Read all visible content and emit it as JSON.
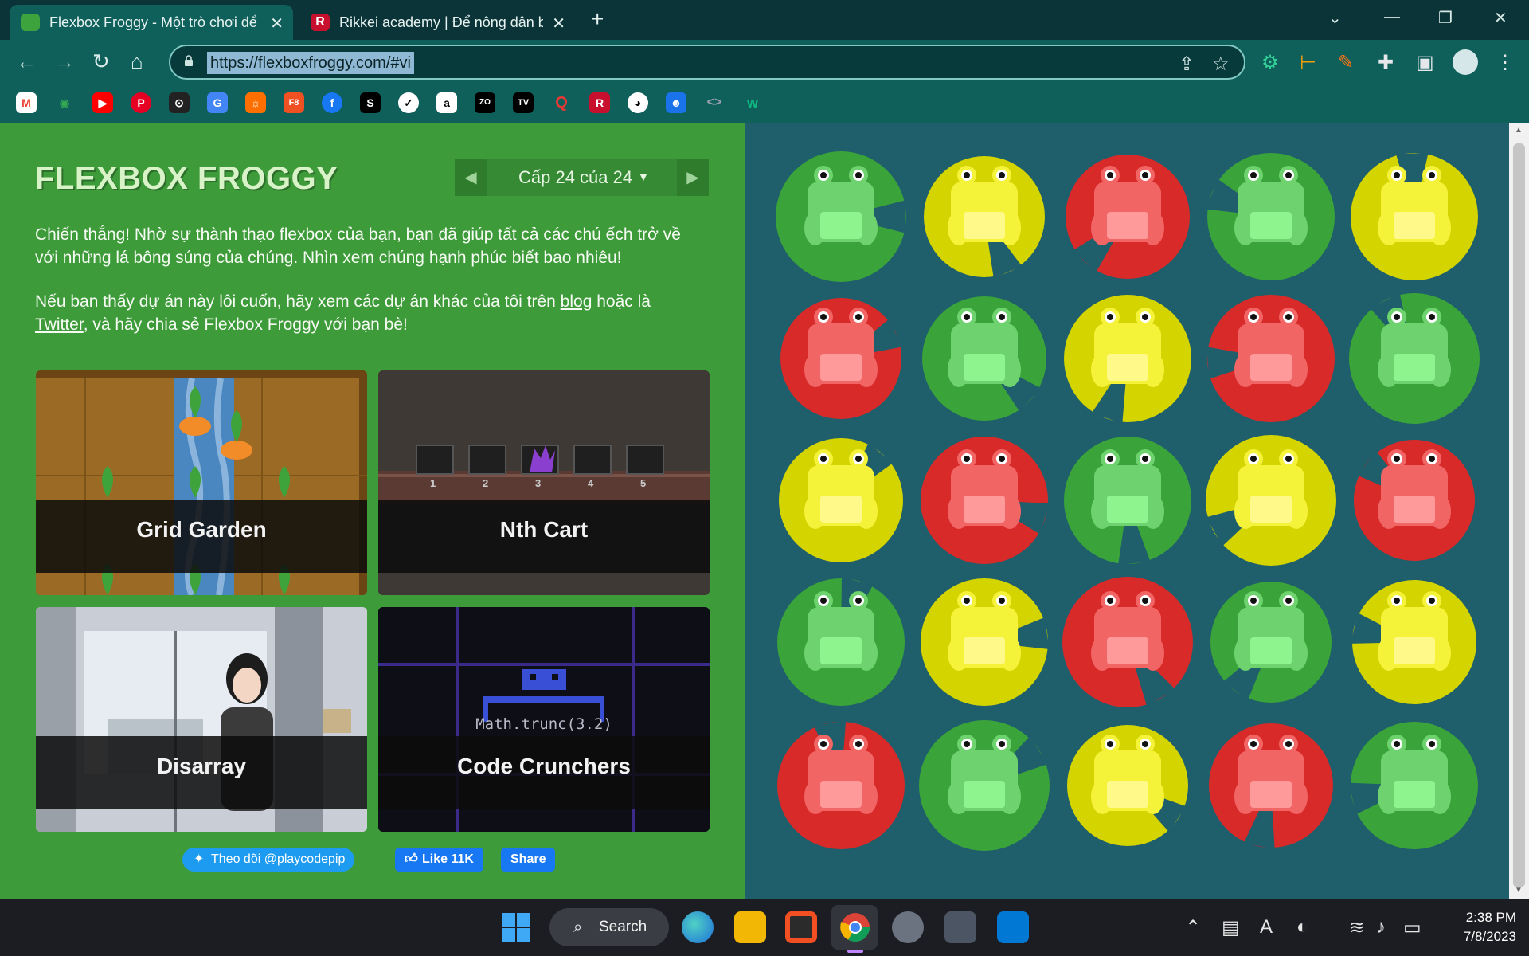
{
  "browser": {
    "tabs": [
      {
        "title": "Flexbox Froggy - Một trò chơi để",
        "active": true
      },
      {
        "title": "Rikkei academy | Để nông dân bi",
        "active": false
      }
    ],
    "new_tab_glyph": "+",
    "url": "https://flexboxfroggy.com/#vi",
    "bookmark_icons": [
      "gmail-icon",
      "maps-icon",
      "youtube-icon",
      "pinterest-icon",
      "zoom-icon",
      "translate-icon",
      "extension-icon",
      "f8-icon",
      "facebook-icon",
      "s-icon",
      "nike-icon",
      "amazon-icon",
      "zozo-icon",
      "tradingview-icon",
      "q-icon",
      "r-icon",
      "github-icon",
      "contacts-icon",
      "code-icon",
      "w-icon"
    ]
  },
  "page": {
    "logo": "FLEXBOX FROGGY",
    "level_label": "Cấp 24 của 24",
    "victory_text": "Chiến thắng! Nhờ sự thành thạo flexbox của bạn, bạn đã giúp tất cả các chú ếch trở về với những lá bông súng của chúng. Nhìn xem chúng hạnh phúc biết bao nhiêu!",
    "promo": {
      "before": "Nếu bạn thấy dự án này lôi cuốn, hãy xem các dự án khác của tôi trên ",
      "blog": "blog",
      "middle": " hoặc là ",
      "twitter": "Twitter",
      "after": ", và hãy chia sẻ Flexbox Froggy với bạn bè!"
    },
    "cards": [
      {
        "title": "Grid Garden"
      },
      {
        "title": "Nth Cart",
        "cart_numbers": [
          "1",
          "2",
          "3",
          "4",
          "5"
        ]
      },
      {
        "title": "Disarray"
      },
      {
        "title": "Code Crunchers",
        "code": "Math.trunc(3.2)"
      }
    ],
    "social": {
      "follow": "Theo dõi @playcodepip",
      "like": "Like 11K",
      "share": "Share"
    },
    "pond_rows": [
      [
        "green",
        "yellow",
        "red",
        "green",
        "yellow"
      ],
      [
        "red",
        "green",
        "yellow",
        "red",
        "green"
      ],
      [
        "yellow",
        "red",
        "green",
        "yellow",
        "red"
      ],
      [
        "green",
        "yellow",
        "red",
        "green",
        "yellow"
      ],
      [
        "red",
        "green",
        "yellow",
        "red",
        "green"
      ]
    ],
    "colors": {
      "green": "#3aa33a",
      "yellow": "#d4d400",
      "red": "#d92a2a"
    }
  },
  "taskbar": {
    "search_label": "Search",
    "time": "2:38 PM",
    "date": "7/8/2023"
  }
}
